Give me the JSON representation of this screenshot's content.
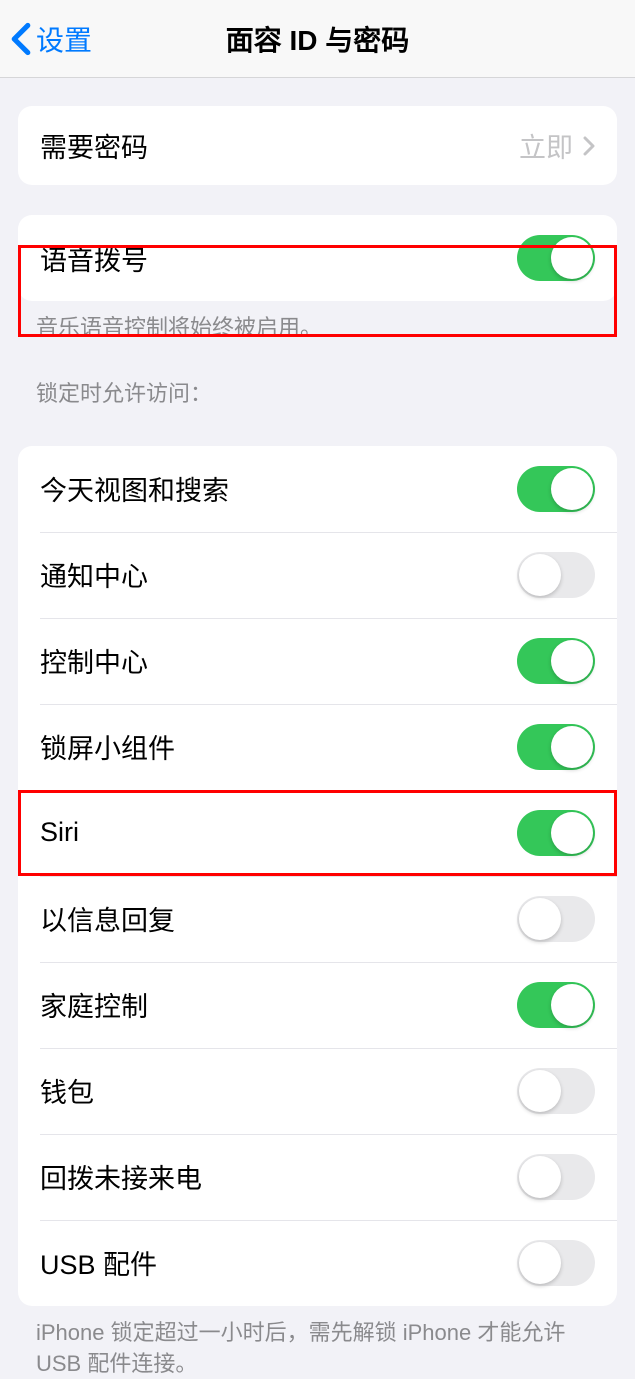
{
  "nav": {
    "back_label": "设置",
    "title": "面容 ID 与密码"
  },
  "groups": {
    "passcode": {
      "label": "需要密码",
      "value": "立即"
    },
    "voice_dial": {
      "label": "语音拨号",
      "on": true,
      "footer": "音乐语音控制将始终被启用。"
    },
    "lock_access": {
      "header": "锁定时允许访问：",
      "items": [
        {
          "label": "今天视图和搜索",
          "on": true
        },
        {
          "label": "通知中心",
          "on": false
        },
        {
          "label": "控制中心",
          "on": true
        },
        {
          "label": "锁屏小组件",
          "on": true
        },
        {
          "label": "Siri",
          "on": true
        },
        {
          "label": "以信息回复",
          "on": false
        },
        {
          "label": "家庭控制",
          "on": true
        },
        {
          "label": "钱包",
          "on": false
        },
        {
          "label": "回拨未接来电",
          "on": false
        },
        {
          "label": "USB 配件",
          "on": false
        }
      ],
      "footer": "iPhone 锁定超过一小时后，需先解锁 iPhone 才能允许USB 配件连接。"
    }
  }
}
